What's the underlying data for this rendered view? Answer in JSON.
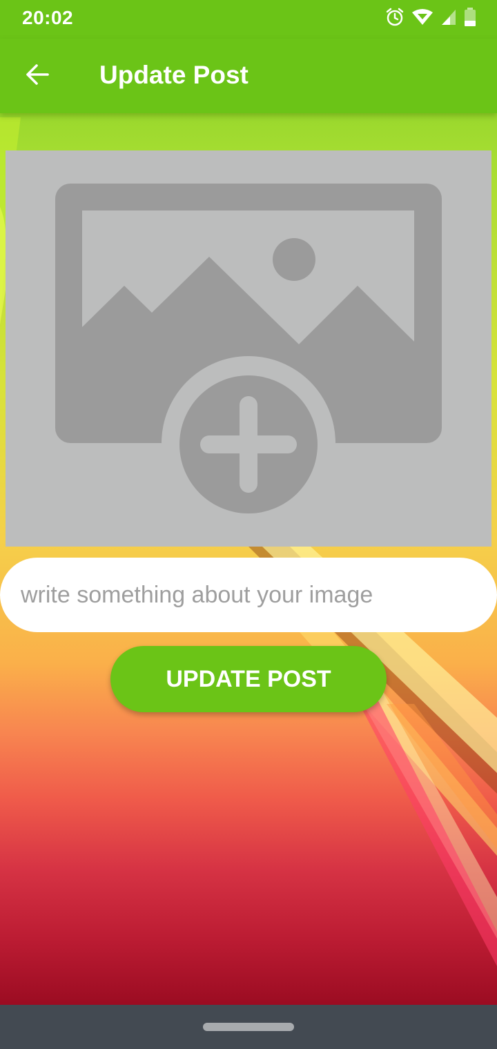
{
  "status_bar": {
    "time": "20:02",
    "icons": [
      "alarm-icon",
      "wifi-icon",
      "cell-signal-icon",
      "battery-icon"
    ]
  },
  "app_bar": {
    "back_icon": "arrow-left-icon",
    "title": "Update Post"
  },
  "image_picker": {
    "icon": "add-photo-icon"
  },
  "caption": {
    "placeholder": "write something about your image",
    "value": ""
  },
  "update_button": {
    "label": "UPDATE POST"
  },
  "nav_bar": {
    "home_indicator": "home-pill"
  },
  "colors": {
    "primary": "#6bc417",
    "placeholder_box": "#bcbdbd",
    "placeholder_icon": "#9b9b9b",
    "nav_bar": "#434a52"
  }
}
